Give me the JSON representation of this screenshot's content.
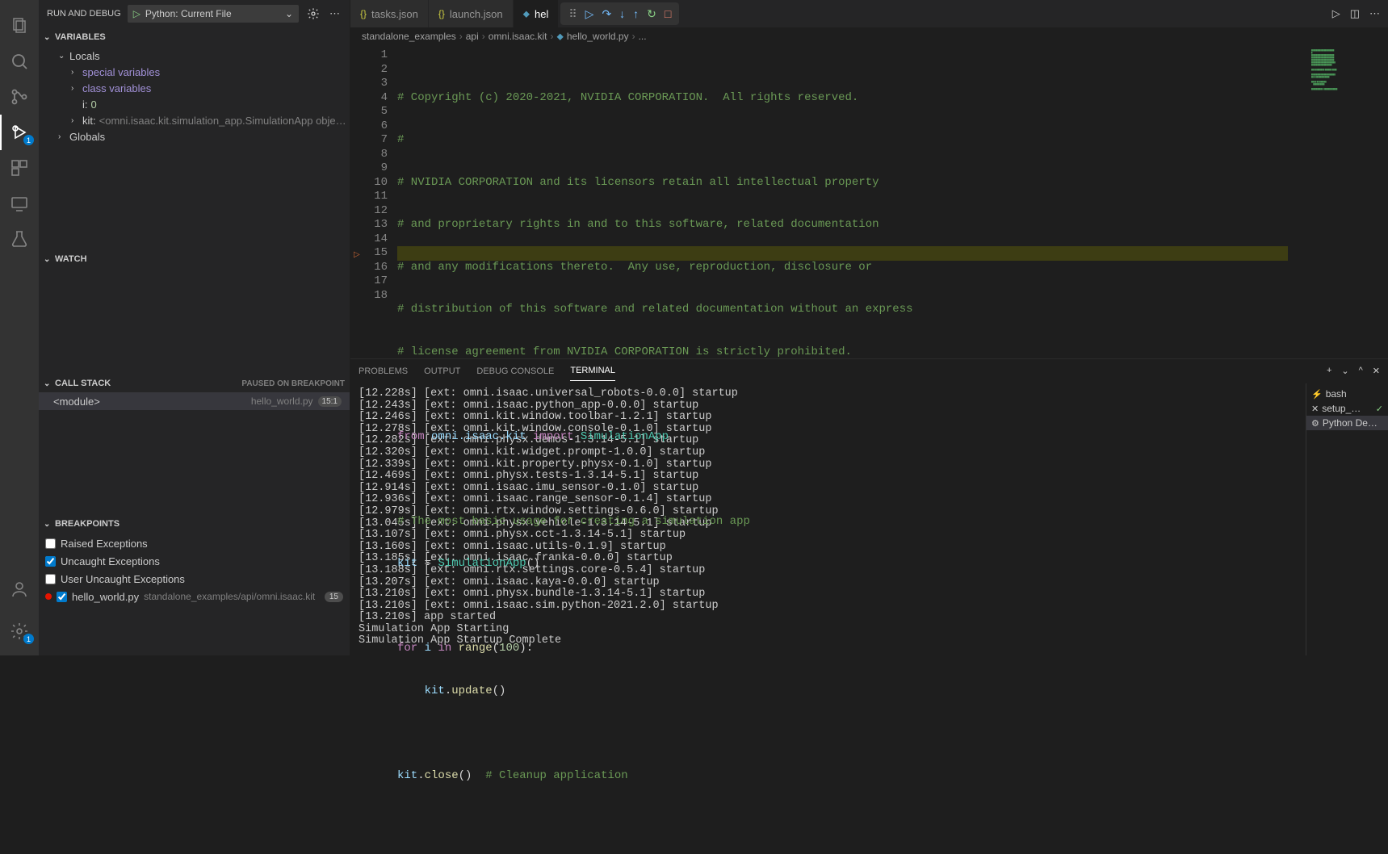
{
  "debug_header": {
    "title": "RUN AND DEBUG",
    "config": "Python: Current File"
  },
  "variables": {
    "title": "VARIABLES",
    "locals_label": "Locals",
    "special_label": "special variables",
    "class_label": "class variables",
    "i_label": "i:",
    "i_val": "0",
    "kit_label": "kit:",
    "kit_val": "<omni.isaac.kit.simulation_app.SimulationApp object a…",
    "globals_label": "Globals"
  },
  "watch": {
    "title": "WATCH"
  },
  "callstack": {
    "title": "CALL STACK",
    "status": "PAUSED ON BREAKPOINT",
    "frame": "<module>",
    "file": "hello_world.py",
    "pos": "15:1"
  },
  "breakpoints": {
    "title": "BREAKPOINTS",
    "raised": "Raised Exceptions",
    "uncaught": "Uncaught Exceptions",
    "user_uncaught": "User Uncaught Exceptions",
    "file": "hello_world.py",
    "file_path": "standalone_examples/api/omni.isaac.kit",
    "line": "15"
  },
  "tabs": {
    "t1": "tasks.json",
    "t2": "launch.json",
    "t3": "hel"
  },
  "breadcrumb": {
    "p1": "standalone_examples",
    "p2": "api",
    "p3": "omni.isaac.kit",
    "p4": "hello_world.py",
    "p5": "..."
  },
  "code": {
    "l1_a": "# Copyright (c) 2020-2021, NVIDIA CORPORATION.  All rights reserved.",
    "l2_a": "#",
    "l3_a": "# NVIDIA CORPORATION and its licensors retain all intellectual property",
    "l4_a": "# and proprietary rights in and to this software, related documentation",
    "l5_a": "# and any modifications thereto.  Any use, reproduction, disclosure or",
    "l6_a": "# distribution of this software and related documentation without an express",
    "l7_a": "# license agreement from NVIDIA CORPORATION is strictly prohibited.",
    "l9_from": "from",
    "l9_mod": " omni.isaac.kit ",
    "l9_imp": "import",
    "l9_cls": " SimulationApp",
    "l11": "# The most basic usage for creating a simulation app",
    "l12_kit": "kit",
    "l12_eq": " = ",
    "l12_cls": "SimulationApp",
    "l12_p": "()",
    "l14_for": "for",
    "l14_i": " i ",
    "l14_in": "in",
    "l14_range": " range",
    "l14_args": "(",
    "l14_n": "100",
    "l14_end": "):",
    "l15_kit": "    kit",
    "l15_dot": ".",
    "l15_upd": "update",
    "l15_p": "()",
    "l17_kit": "kit",
    "l17_dot": ".",
    "l17_close": "close",
    "l17_p": "()",
    "l17_c": "  # Cleanup application"
  },
  "panel_tabs": {
    "problems": "PROBLEMS",
    "output": "OUTPUT",
    "debug": "DEBUG CONSOLE",
    "terminal": "TERMINAL"
  },
  "terminal": {
    "l1": "[12.228s] [ext: omni.isaac.universal_robots-0.0.0] startup",
    "l2": "[12.243s] [ext: omni.isaac.python_app-0.0.0] startup",
    "l3": "[12.246s] [ext: omni.kit.window.toolbar-1.2.1] startup",
    "l4": "[12.278s] [ext: omni.kit.window.console-0.1.0] startup",
    "l5": "[12.282s] [ext: omni.physx.demos-1.3.14-5.1] startup",
    "l6": "[12.320s] [ext: omni.kit.widget.prompt-1.0.0] startup",
    "l7": "[12.339s] [ext: omni.kit.property.physx-0.1.0] startup",
    "l8": "[12.469s] [ext: omni.physx.tests-1.3.14-5.1] startup",
    "l9": "[12.914s] [ext: omni.isaac.imu_sensor-0.1.0] startup",
    "l10": "[12.936s] [ext: omni.isaac.range_sensor-0.1.4] startup",
    "l11": "[12.979s] [ext: omni.rtx.window.settings-0.6.0] startup",
    "l12": "[13.045s] [ext: omni.physx.vehicle-1.3.14-5.1] startup",
    "l13": "[13.107s] [ext: omni.physx.cct-1.3.14-5.1] startup",
    "l14": "[13.160s] [ext: omni.isaac.utils-0.1.9] startup",
    "l15": "[13.185s] [ext: omni.isaac.franka-0.0.0] startup",
    "l16": "[13.188s] [ext: omni.rtx.settings.core-0.5.4] startup",
    "l17": "[13.207s] [ext: omni.isaac.kaya-0.0.0] startup",
    "l18": "[13.210s] [ext: omni.physx.bundle-1.3.14-5.1] startup",
    "l19": "[13.210s] [ext: omni.isaac.sim.python-2021.2.0] startup",
    "l20": "[13.210s] app started",
    "l21": "Simulation App Starting",
    "l22": "Simulation App Startup Complete"
  },
  "terminal_side": {
    "bash": "bash",
    "setup": "setup_…",
    "python": "Python De…"
  }
}
